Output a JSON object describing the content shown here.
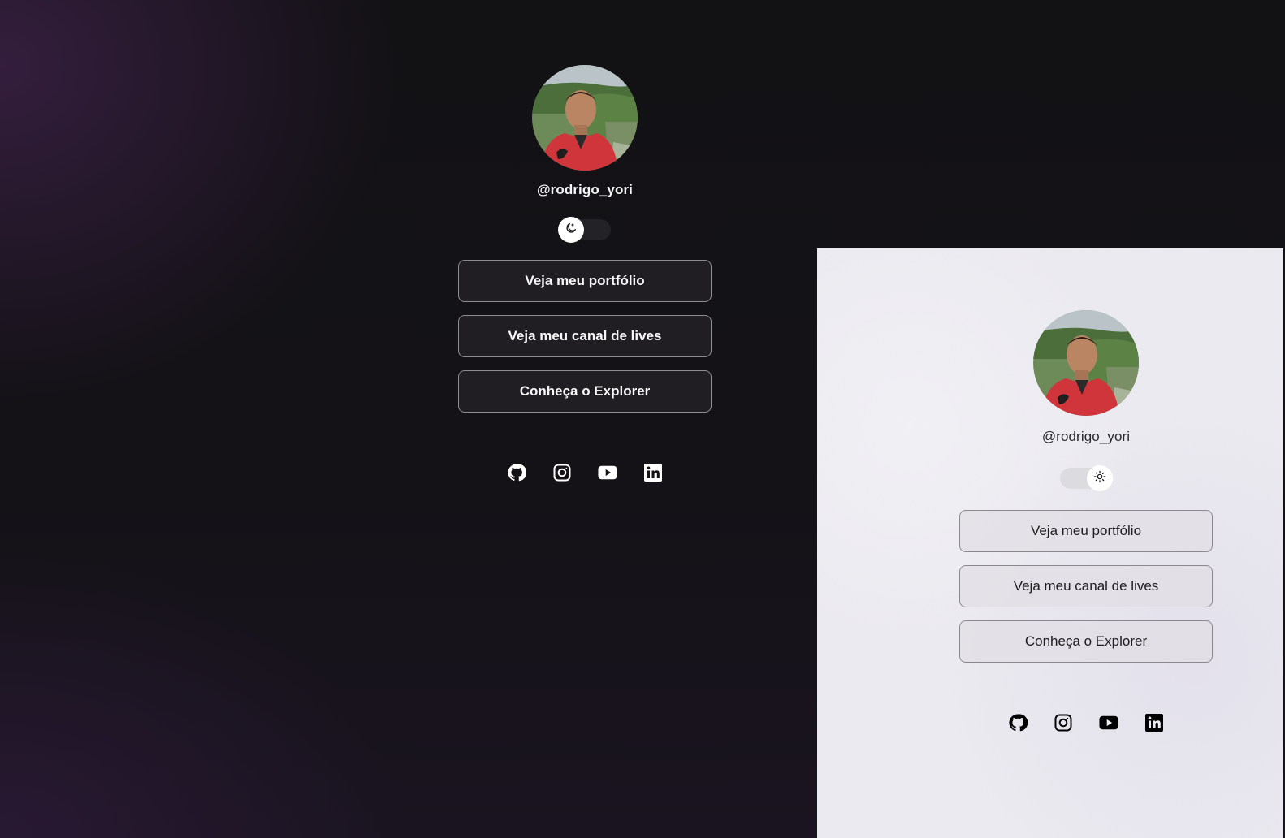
{
  "dark_theme": {
    "username": "@rodrigo_yori",
    "toggle": {
      "state": "dark",
      "icon": "moon-icon"
    },
    "links": [
      {
        "label": "Veja meu portfólio"
      },
      {
        "label": "Veja meu canal de lives"
      },
      {
        "label": "Conheça o Explorer"
      }
    ],
    "socials": [
      "github-icon",
      "instagram-icon",
      "youtube-icon",
      "linkedin-icon"
    ],
    "colors": {
      "background": "#131216",
      "button_bg": "#232126",
      "button_border": "#8e8c91",
      "text": "#f5f5f7"
    }
  },
  "light_theme": {
    "username": "@rodrigo_yori",
    "toggle": {
      "state": "light",
      "icon": "sun-icon"
    },
    "links": [
      {
        "label": "Veja meu portfólio"
      },
      {
        "label": "Veja meu canal de lives"
      },
      {
        "label": "Conheça o Explorer"
      }
    ],
    "socials": [
      "github-icon",
      "instagram-icon",
      "youtube-icon",
      "linkedin-icon"
    ],
    "colors": {
      "background": "#ecebf1",
      "button_bg": "#e1dee4",
      "button_border": "#8b898e",
      "text": "#1d1d20"
    }
  }
}
